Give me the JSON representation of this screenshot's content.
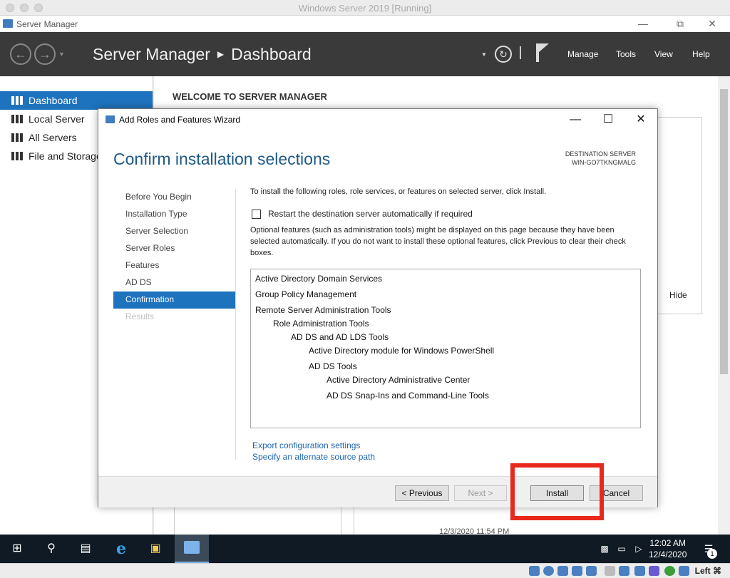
{
  "vm": {
    "title": "Windows Server 2019 [Running]",
    "host_key": "Left ⌘"
  },
  "app": {
    "title": "Server Manager"
  },
  "header": {
    "app_name": "Server Manager",
    "page": "Dashboard",
    "menu": [
      "Manage",
      "Tools",
      "View",
      "Help"
    ]
  },
  "sidebar": {
    "items": [
      {
        "label": "Dashboard",
        "active": true
      },
      {
        "label": "Local Server",
        "active": false
      },
      {
        "label": "All Servers",
        "active": false
      },
      {
        "label": "File and Storage Services",
        "active": false
      }
    ]
  },
  "main": {
    "welcome": "WELCOME TO SERVER MANAGER",
    "hide": "Hide",
    "timestamp": "12/3/2020 11:54 PM"
  },
  "dialog": {
    "title": "Add Roles and Features Wizard",
    "heading": "Confirm installation selections",
    "dest_label": "DESTINATION SERVER",
    "dest_server": "WIN-GO7TKNGMALG",
    "steps": [
      {
        "label": "Before You Begin",
        "state": "normal"
      },
      {
        "label": "Installation Type",
        "state": "normal"
      },
      {
        "label": "Server Selection",
        "state": "normal"
      },
      {
        "label": "Server Roles",
        "state": "normal"
      },
      {
        "label": "Features",
        "state": "normal"
      },
      {
        "label": "AD DS",
        "state": "normal"
      },
      {
        "label": "Confirmation",
        "state": "active"
      },
      {
        "label": "Results",
        "state": "disabled"
      }
    ],
    "intro": "To install the following roles, role services, or features on selected server, click Install.",
    "restart_label": "Restart the destination server automatically if required",
    "restart_checked": false,
    "optional_text": "Optional features (such as administration tools) might be displayed on this page because they have been selected automatically. If you do not want to install these optional features, click Previous to clear their check boxes.",
    "items": [
      {
        "label": "Active Directory Domain Services",
        "level": 0
      },
      {
        "label": "Group Policy Management",
        "level": 0
      },
      {
        "label": "Remote Server Administration Tools",
        "level": 0
      },
      {
        "label": "Role Administration Tools",
        "level": 1
      },
      {
        "label": "AD DS and AD LDS Tools",
        "level": 2
      },
      {
        "label": "Active Directory module for Windows PowerShell",
        "level": 3
      },
      {
        "label": "AD DS Tools",
        "level": 3
      },
      {
        "label": "Active Directory Administrative Center",
        "level": 4
      },
      {
        "label": "AD DS Snap-Ins and Command-Line Tools",
        "level": 4
      }
    ],
    "export_link": "Export configuration settings",
    "alt_source_link": "Specify an alternate source path",
    "buttons": {
      "previous": "< Previous",
      "next": "Next >",
      "install": "Install",
      "cancel": "Cancel"
    }
  },
  "taskbar": {
    "time": "12:02 AM",
    "date": "12/4/2020",
    "notifications": "1"
  }
}
